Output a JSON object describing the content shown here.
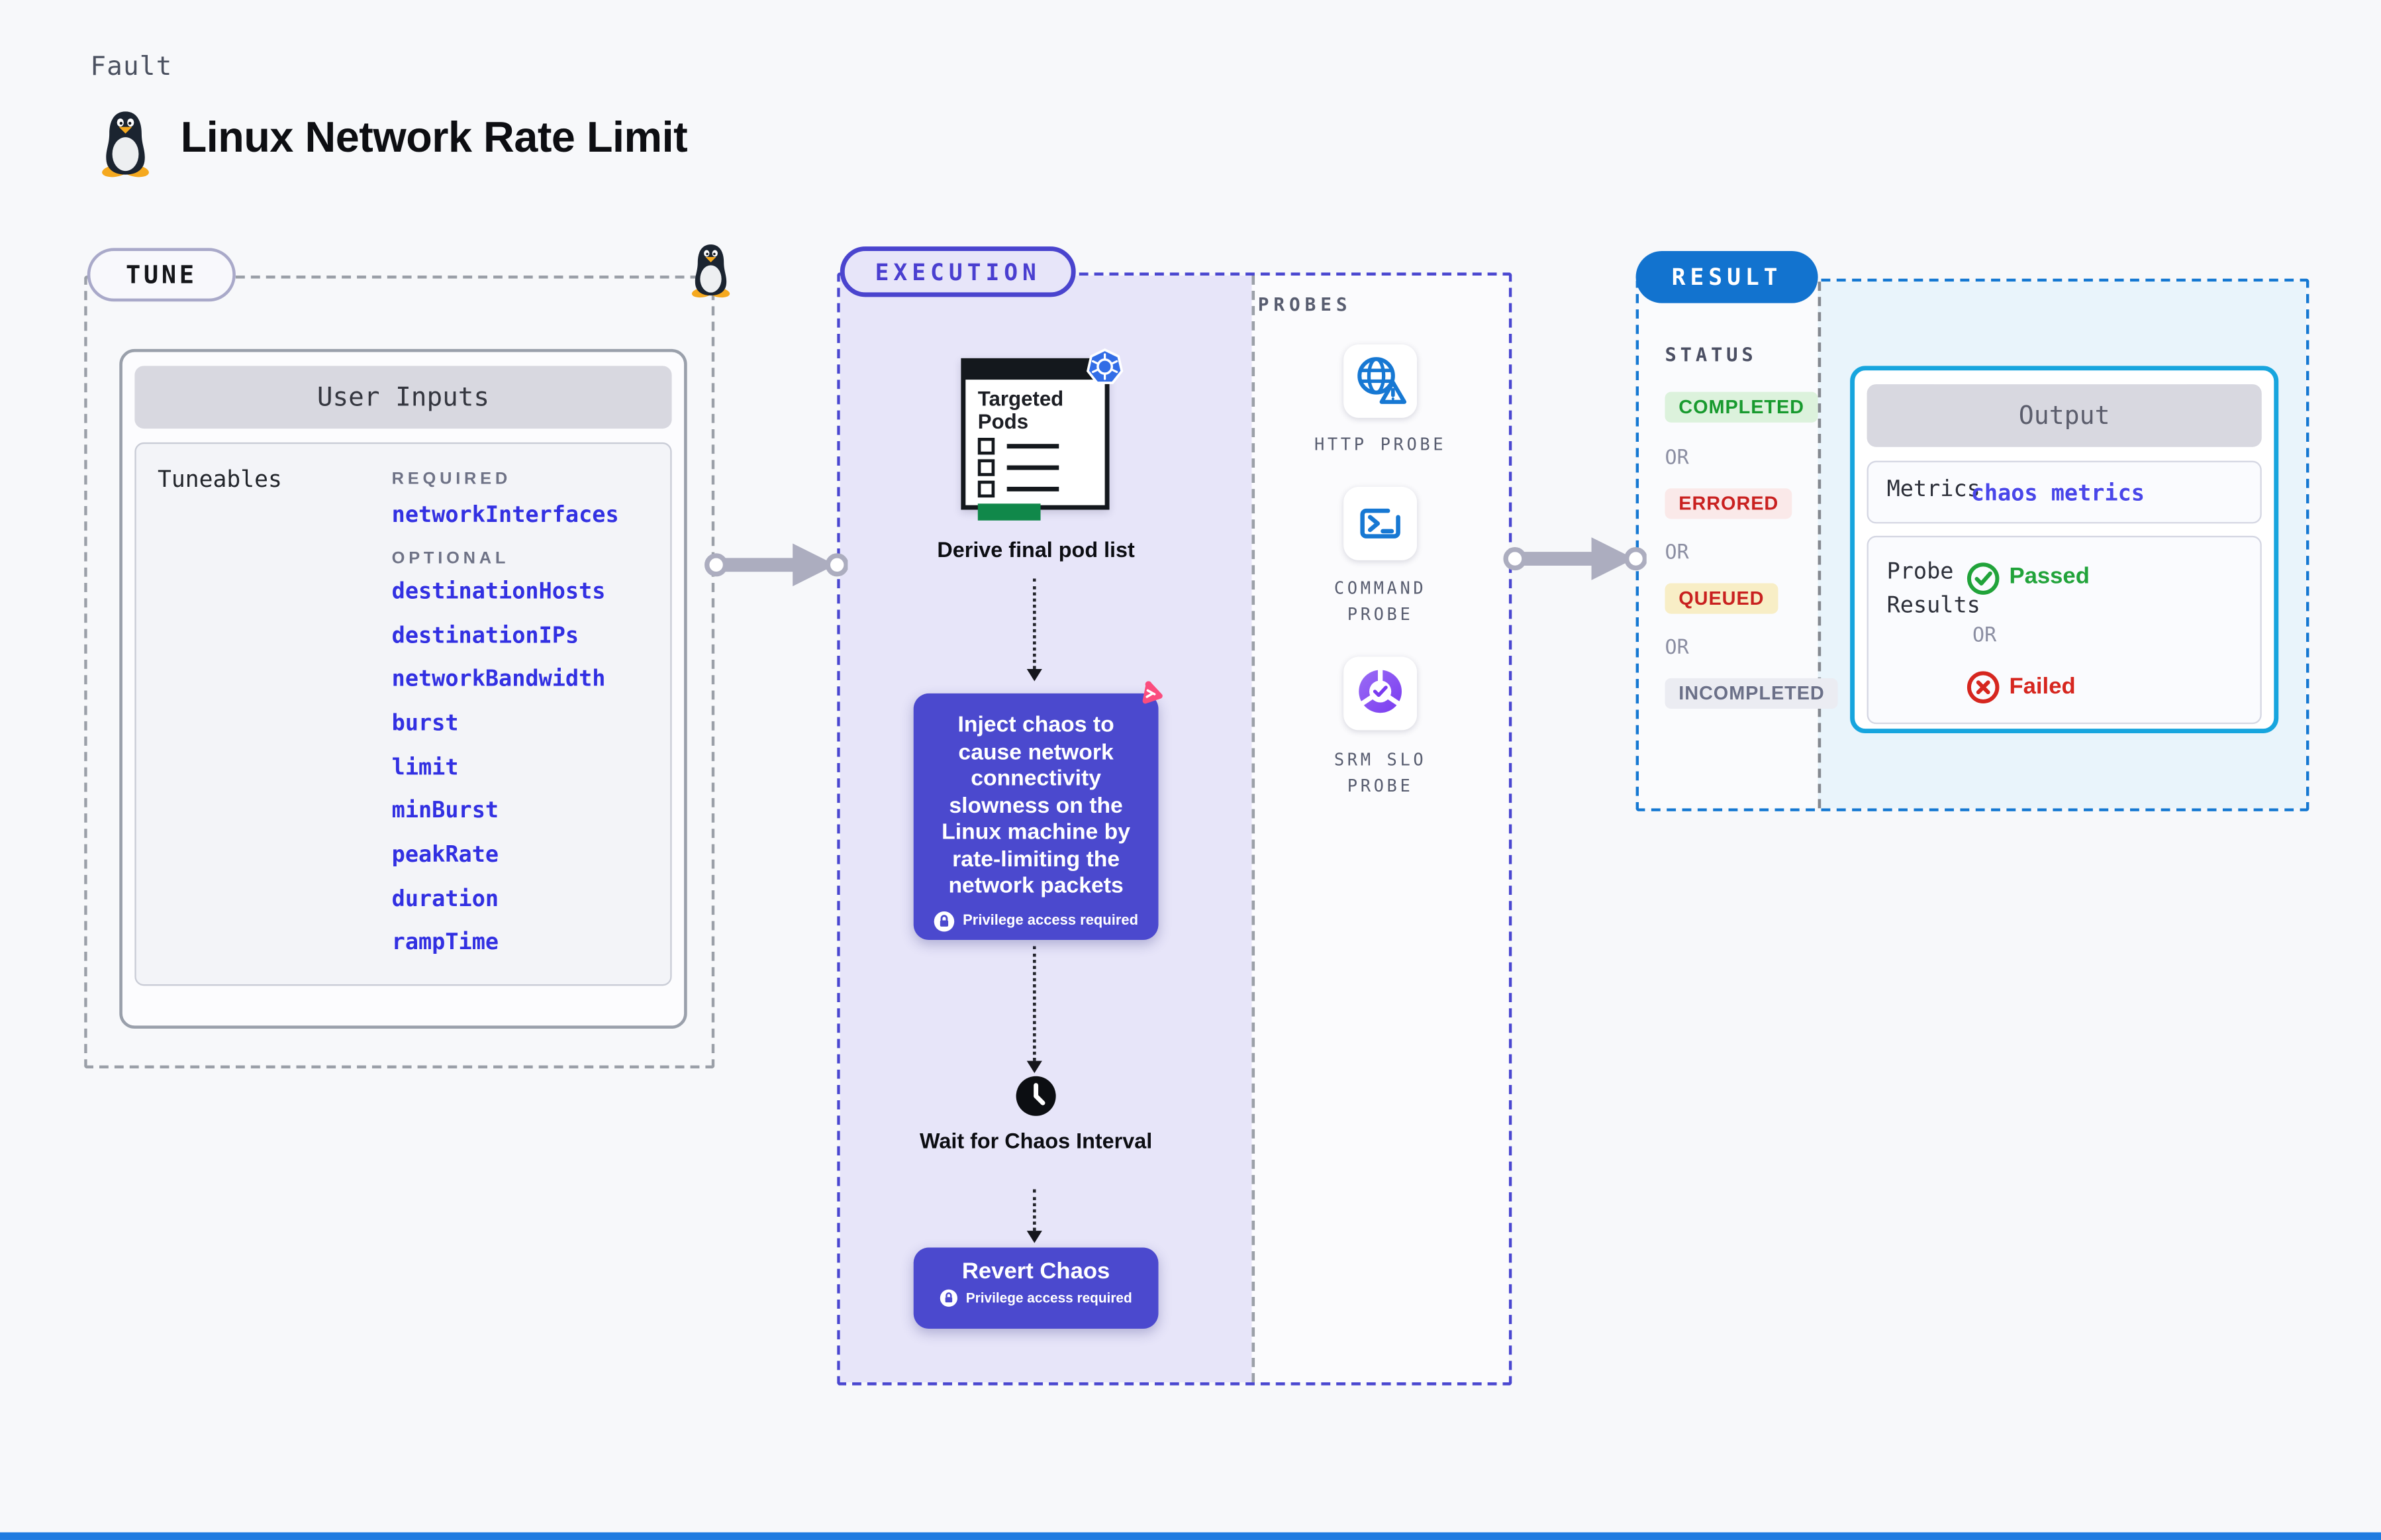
{
  "header": {
    "kicker": "Fault",
    "title": "Linux Network Rate Limit"
  },
  "tune": {
    "label": "TUNE",
    "user_inputs_title": "User Inputs",
    "tuneables_label": "Tuneables",
    "required_label": "REQUIRED",
    "required_items": [
      "networkInterfaces"
    ],
    "optional_label": "OPTIONAL",
    "optional_items": [
      "destinationHosts",
      "destinationIPs",
      "networkBandwidth",
      "burst",
      "limit",
      "minBurst",
      "peakRate",
      "duration",
      "rampTime"
    ]
  },
  "execution": {
    "label": "EXECUTION",
    "pods_icon_title": "Targeted Pods",
    "derive_label": "Derive final pod list",
    "inject_text": "Inject chaos to cause network connectivity slowness on the Linux machine by rate-limiting the network packets",
    "privilege_label": "Privilege access required",
    "wait_label": "Wait for Chaos Interval",
    "revert_label": "Revert Chaos"
  },
  "probes": {
    "label": "PROBES",
    "items": [
      {
        "label": "HTTP PROBE",
        "icon": "globe-alert-icon"
      },
      {
        "label": "COMMAND PROBE",
        "icon": "terminal-icon"
      },
      {
        "label": "SRM SLO PROBE",
        "icon": "slo-donut-icon"
      }
    ]
  },
  "result": {
    "label": "RESULT",
    "status_label": "STATUS",
    "or_label": "OR",
    "statuses": [
      {
        "label": "COMPLETED",
        "tone": "success"
      },
      {
        "label": "ERRORED",
        "tone": "error"
      },
      {
        "label": "QUEUED",
        "tone": "queued"
      },
      {
        "label": "INCOMPLETED",
        "tone": "incomplete"
      }
    ],
    "output_title": "Output",
    "metrics_label": "Metrics",
    "metrics_value": "chaos metrics",
    "probe_results_label": "Probe Results",
    "passed_label": "Passed",
    "failed_label": "Failed"
  },
  "colors": {
    "accent_indigo": "#4a46cf",
    "chaos_box_purple": "#4b49ce",
    "result_blue": "#1273cf",
    "output_border_cyan": "#17a5de",
    "kubernetes_blue": "#326de6",
    "probe_icon_blue": "#1778d3",
    "tuneable_link_blue": "#3230e2",
    "success_green": "#189a2e",
    "error_red": "#c92120",
    "queued_badge_bg": "#f8eec6",
    "chaos_logo_pink": "#fb4d7e",
    "bottom_bar_blue": "#1f7be0"
  }
}
